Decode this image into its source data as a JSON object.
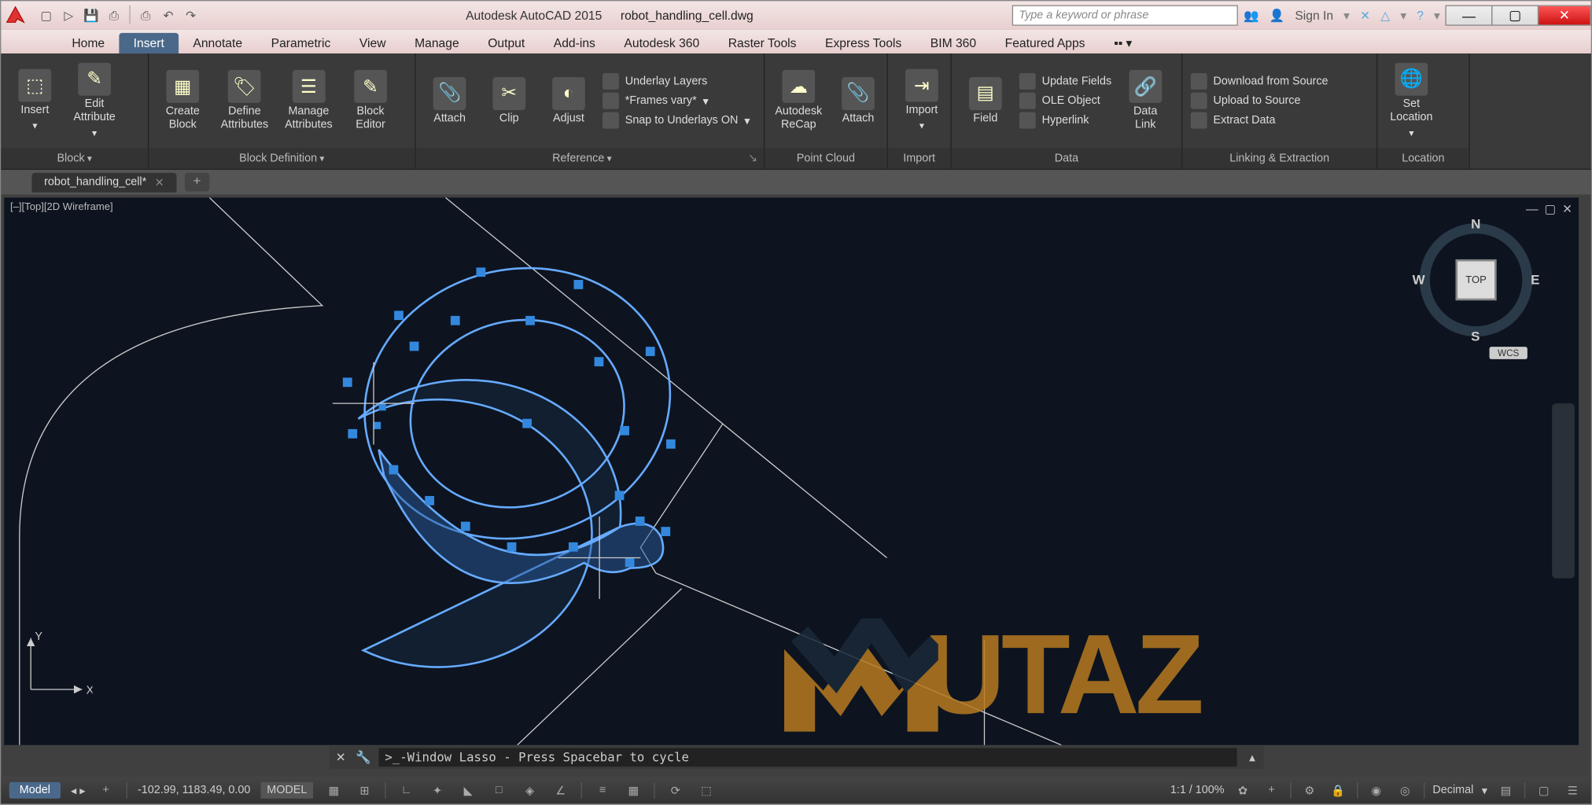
{
  "title": {
    "app": "Autodesk AutoCAD 2015",
    "file": "robot_handling_cell.dwg"
  },
  "search_placeholder": "Type a keyword or phrase",
  "signin": "Sign In",
  "menutabs": [
    "Home",
    "Insert",
    "Annotate",
    "Parametric",
    "View",
    "Manage",
    "Output",
    "Add-ins",
    "Autodesk 360",
    "Raster Tools",
    "Express Tools",
    "BIM 360",
    "Featured Apps"
  ],
  "active_tab": 1,
  "ribbon": {
    "block": {
      "title": "Block",
      "insert": "Insert",
      "edit": "Edit\nAttribute"
    },
    "blockdef": {
      "title": "Block Definition",
      "create": "Create\nBlock",
      "define": "Define\nAttributes",
      "manage": "Manage\nAttributes",
      "editor": "Block\nEditor"
    },
    "reference": {
      "title": "Reference",
      "attach": "Attach",
      "clip": "Clip",
      "adjust": "Adjust",
      "underlay": "Underlay Layers",
      "frames": "*Frames vary*",
      "snap": "Snap to Underlays ON"
    },
    "pointcloud": {
      "title": "Point Cloud",
      "recap": "Autodesk\nReCap",
      "attach": "Attach"
    },
    "import": {
      "title": "Import",
      "import": "Import"
    },
    "data": {
      "title": "Data",
      "field": "Field",
      "datalink": "Data\nLink",
      "update": "Update Fields",
      "ole": "OLE Object",
      "hyper": "Hyperlink"
    },
    "linking": {
      "title": "Linking & Extraction",
      "download": "Download from Source",
      "upload": "Upload to Source",
      "extract": "Extract  Data"
    },
    "location": {
      "title": "Location",
      "set": "Set\nLocation"
    }
  },
  "filetab": "robot_handling_cell*",
  "viewport": {
    "label": "[–][Top][2D Wireframe]",
    "cube": "TOP",
    "wcs": "WCS"
  },
  "watermark": "UTAZ",
  "cmd": ">_-Window Lasso - Press Spacebar to cycle",
  "status": {
    "model": "Model",
    "coords": "-102.99, 1183.49, 0.00",
    "space": "MODEL",
    "scale": "1:1 / 100%",
    "units": "Decimal"
  },
  "ucs": {
    "x": "X",
    "y": "Y"
  },
  "compass": {
    "n": "N",
    "s": "S",
    "e": "E",
    "w": "W"
  }
}
